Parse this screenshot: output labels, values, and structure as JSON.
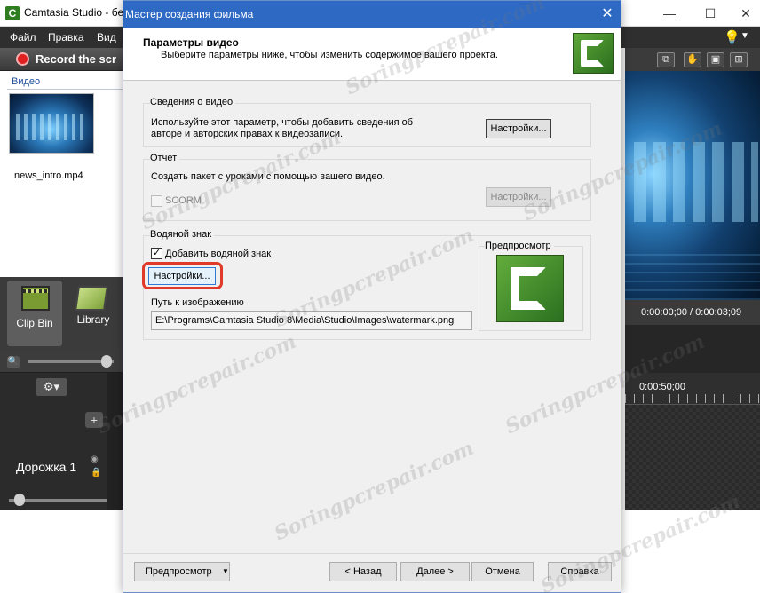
{
  "background_app": {
    "title": "Camtasia Studio - бе",
    "menu": [
      "Файл",
      "Правка",
      "Вид"
    ],
    "record_label": "Record the scr",
    "clip_bin_title": "Видео",
    "clip_name": "news_intro.mp4",
    "tabs": {
      "clip_bin": "Clip Bin",
      "library": "Library"
    },
    "track_label": "Дорожка 1",
    "timecode": "0:00:00;00 / 0:00:03;09",
    "ruler_label": "0:00:50;00",
    "preview_tools": [
      "⧉",
      "✋",
      "▣",
      "⊞",
      "⛶"
    ]
  },
  "dialog": {
    "title": "Мастер создания фильма",
    "header_title": "Параметры видео",
    "header_subtitle": "Выберите параметры ниже, чтобы изменить содержимое вашего проекта.",
    "video_info": {
      "title": "Сведения о видео",
      "description_line1": "Используйте этот параметр, чтобы добавить сведения об",
      "description_line2": "авторе и авторских правах к видеозаписи.",
      "settings_button": "Настройки..."
    },
    "report": {
      "title": "Отчет",
      "description": "Создать пакет с уроками с помощью вашего видео.",
      "scorm_label": "SCORM",
      "scorm_checked": false,
      "settings_button": "Настройки..."
    },
    "watermark": {
      "title": "Водяной знак",
      "add_label": "Добавить водяной знак",
      "add_checked": true,
      "settings_button": "Настройки...",
      "path_label": "Путь к изображению",
      "path_value": "E:\\Programs\\Camtasia Studio 8\\Media\\Studio\\Images\\watermark.png",
      "preview_label": "Предпросмотр"
    },
    "footer": {
      "preview_button": "Предпросмотр",
      "back_button": "< Назад",
      "next_button": "Далее >",
      "cancel_button": "Отмена",
      "help_button": "Справка"
    }
  },
  "watermark_text": "Soringpcrepair.com",
  "colors": {
    "dialog_title_bar": "#2e6ac4",
    "highlight_outline": "#e03a2a",
    "camtasia_green": "#2f7d20"
  }
}
